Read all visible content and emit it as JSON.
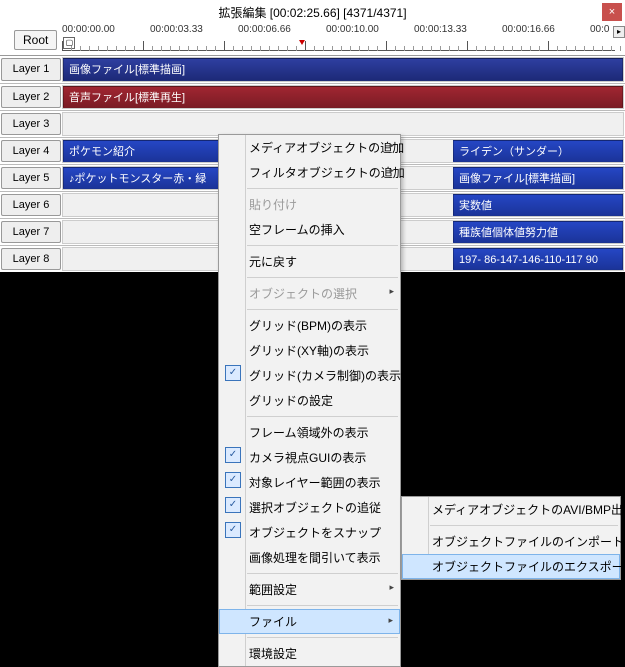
{
  "window": {
    "title": "拡張編集 [00:02:25.66] [4371/4371]",
    "close": "×"
  },
  "toolbar": {
    "root": "Root"
  },
  "ruler": {
    "labels": [
      "00:00:00.00",
      "00:00:03.33",
      "00:00:06.66",
      "00:00:10.00",
      "00:00:13.33",
      "00:00:16.66",
      "00:0"
    ]
  },
  "layers": [
    {
      "label": "Layer 1",
      "clips": [
        {
          "text": "画像ファイル[標準描画]",
          "cls": "blue",
          "l": 0,
          "r": 0
        }
      ]
    },
    {
      "label": "Layer 2",
      "clips": [
        {
          "text": "音声ファイル[標準再生]",
          "cls": "red",
          "l": 0,
          "r": 0
        }
      ]
    },
    {
      "label": "Layer 3",
      "clips": []
    },
    {
      "label": "Layer 4",
      "clips": [
        {
          "text": "ポケモン紹介",
          "cls": "blue2",
          "l": 0,
          "r": 399
        },
        {
          "text": "ライデン（サンダー）",
          "cls": "blue2",
          "l": 390,
          "r": 0
        }
      ]
    },
    {
      "label": "Layer 5",
      "clips": [
        {
          "text": "♪ポケットモンスター赤・緑",
          "cls": "blue2",
          "l": 0,
          "r": 399
        },
        {
          "text": "画像ファイル[標準描画]",
          "cls": "blue2",
          "l": 390,
          "r": 0
        }
      ]
    },
    {
      "label": "Layer 6",
      "clips": [
        {
          "text": "実数値",
          "cls": "blue2",
          "l": 390,
          "r": 0
        }
      ]
    },
    {
      "label": "Layer 7",
      "clips": [
        {
          "text": "種族値個体値努力値",
          "cls": "blue2",
          "l": 390,
          "r": 0
        }
      ]
    },
    {
      "label": "Layer 8",
      "clips": [
        {
          "text": "197- 86-147-146-110-117 90",
          "cls": "blue2",
          "l": 390,
          "r": 0
        }
      ]
    }
  ],
  "menu": {
    "items": [
      {
        "t": "メディアオブジェクトの追加",
        "sub": true
      },
      {
        "t": "フィルタオブジェクトの追加",
        "sub": true
      },
      {
        "sep": true
      },
      {
        "t": "貼り付け",
        "dis": true
      },
      {
        "t": "空フレームの挿入"
      },
      {
        "sep": true
      },
      {
        "t": "元に戻す"
      },
      {
        "sep": true
      },
      {
        "t": "オブジェクトの選択",
        "dis": true,
        "sub": true
      },
      {
        "sep": true
      },
      {
        "t": "グリッド(BPM)の表示"
      },
      {
        "t": "グリッド(XY軸)の表示"
      },
      {
        "t": "グリッド(カメラ制御)の表示",
        "chk": true
      },
      {
        "t": "グリッドの設定"
      },
      {
        "sep": true
      },
      {
        "t": "フレーム領域外の表示"
      },
      {
        "t": "カメラ視点GUIの表示",
        "chk": true
      },
      {
        "t": "対象レイヤー範囲の表示",
        "chk": true
      },
      {
        "t": "選択オブジェクトの追従",
        "chk": true
      },
      {
        "t": "オブジェクトをスナップ",
        "chk": true
      },
      {
        "t": "画像処理を間引いて表示"
      },
      {
        "sep": true
      },
      {
        "t": "範囲設定",
        "sub": true
      },
      {
        "sep": true
      },
      {
        "t": "ファイル",
        "sub": true,
        "hl": true
      },
      {
        "sep": true
      },
      {
        "t": "環境設定"
      }
    ]
  },
  "submenu": {
    "items": [
      {
        "t": "メディアオブジェクトのAVI/BMP出力(RGBA)"
      },
      {
        "sep": true
      },
      {
        "t": "オブジェクトファイルのインポート"
      },
      {
        "t": "オブジェクトファイルのエクスポート",
        "hl": true
      }
    ]
  }
}
